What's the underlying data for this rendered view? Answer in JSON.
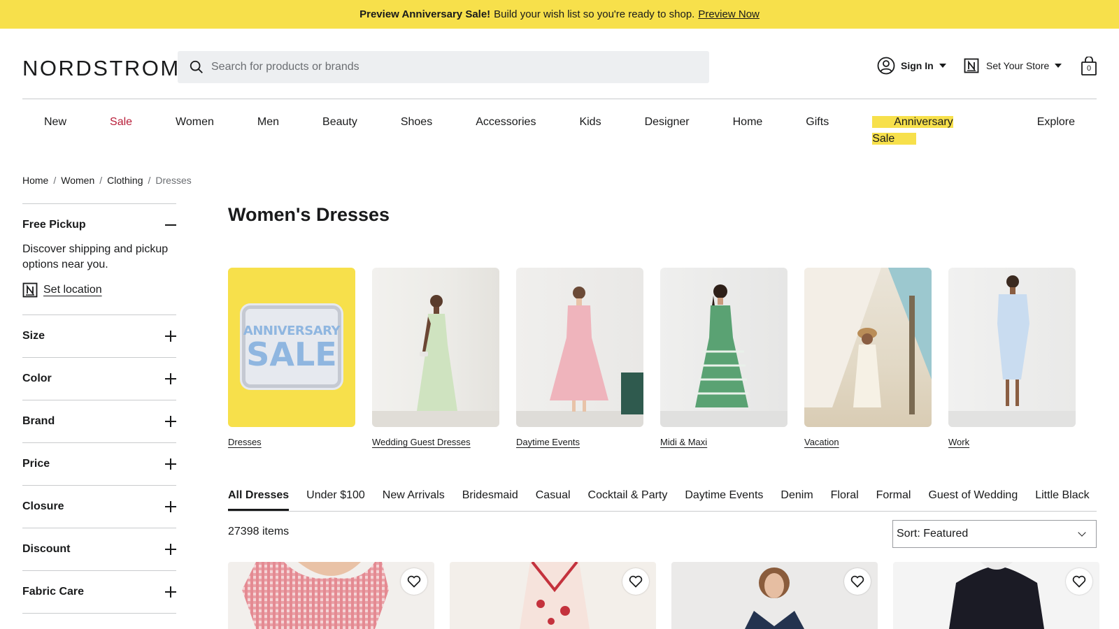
{
  "promo": {
    "bold": "Preview Anniversary Sale!",
    "text": "Build your wish list so you're ready to shop.",
    "link": "Preview Now"
  },
  "header": {
    "logo": "NORDSTROM",
    "search_placeholder": "Search for products or brands",
    "sign_in": "Sign In",
    "store": "Set Your Store",
    "bag_count": "0"
  },
  "nav": [
    "New",
    "Sale",
    "Women",
    "Men",
    "Beauty",
    "Shoes",
    "Accessories",
    "Kids",
    "Designer",
    "Home",
    "Gifts",
    "Anniversary Sale",
    "Explore"
  ],
  "breadcrumb": [
    "Home",
    "Women",
    "Clothing",
    "Dresses"
  ],
  "sidebar": {
    "pickup_title": "Free Pickup",
    "pickup_desc": "Discover shipping and pickup options near you.",
    "set_location": "Set location",
    "filters": [
      "Size",
      "Color",
      "Brand",
      "Price",
      "Closure",
      "Discount",
      "Fabric Care"
    ]
  },
  "page_title": "Women's Dresses",
  "tiles": [
    {
      "label": "Dresses",
      "badge_top": "ANNIVERSARY",
      "badge_bottom": "SALE"
    },
    {
      "label": "Wedding Guest Dresses"
    },
    {
      "label": "Daytime Events"
    },
    {
      "label": "Midi & Maxi"
    },
    {
      "label": "Vacation"
    },
    {
      "label": "Work"
    }
  ],
  "filter_tabs": [
    "All Dresses",
    "Under $100",
    "New Arrivals",
    "Bridesmaid",
    "Casual",
    "Cocktail & Party",
    "Daytime Events",
    "Denim",
    "Floral",
    "Formal",
    "Guest of Wedding",
    "Little Black"
  ],
  "item_count": "27398 items",
  "sort_label": "Sort: Featured",
  "colors": {
    "banner": "#f7e04b",
    "sale_red": "#b81d38",
    "text": "#191a1b"
  }
}
